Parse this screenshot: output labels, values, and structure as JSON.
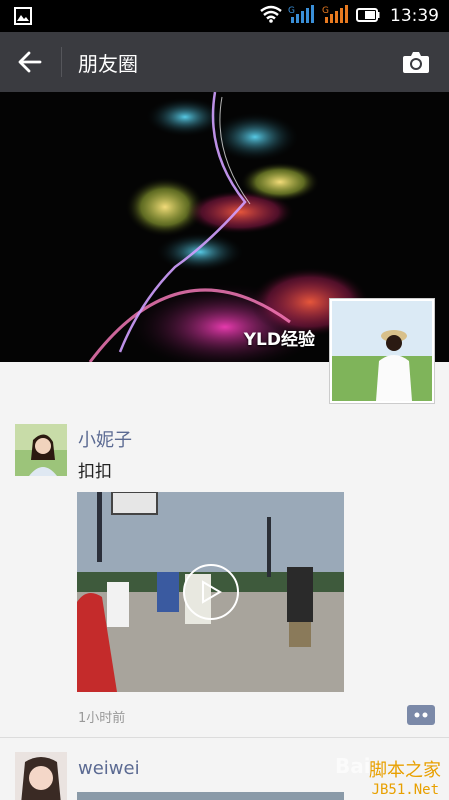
{
  "status_bar": {
    "time": "13:39",
    "signal_labels": [
      "G",
      "G"
    ],
    "icons": [
      "image-notification-icon",
      "wifi-icon",
      "signal-icon",
      "signal-icon",
      "battery-icon"
    ]
  },
  "header": {
    "title": "朋友圈",
    "back_icon": "back-arrow-icon",
    "camera_icon": "camera-icon"
  },
  "cover": {
    "user_name": "YLD经验"
  },
  "posts": [
    {
      "name": "小妮子",
      "text": "扣扣",
      "time": "1小时前",
      "media": "video",
      "media_icon": "play-icon",
      "comment_icon": "comment-icon"
    },
    {
      "name": "weiwei"
    }
  ],
  "watermark": {
    "line1": "脚本之家",
    "line2": "JB51.Net",
    "baidu": "Bai"
  }
}
